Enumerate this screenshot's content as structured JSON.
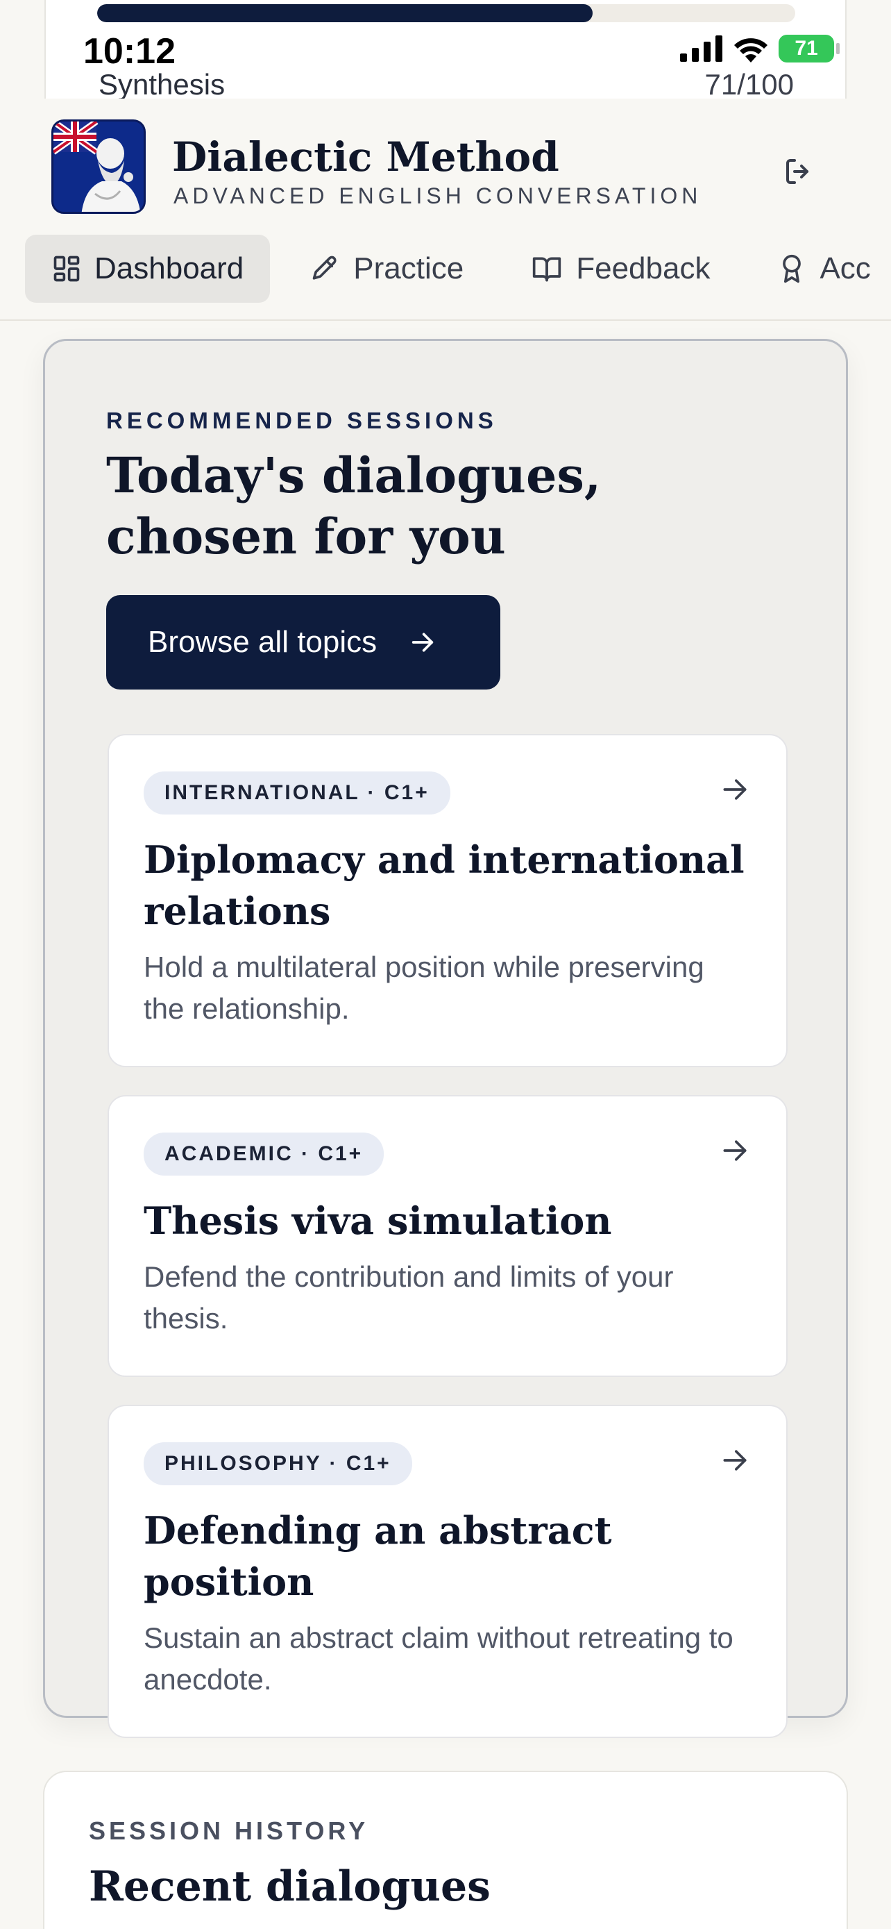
{
  "status_bar": {
    "time": "10:12",
    "battery": "71"
  },
  "progress": {
    "label": "Synthesis",
    "score_text": "71/100",
    "fraction": 0.71
  },
  "app": {
    "title": "Dialectic Method",
    "subtitle": "ADVANCED ENGLISH CONVERSATION"
  },
  "nav": {
    "items": [
      {
        "label": "Dashboard",
        "icon": "dashboard-icon",
        "active": true
      },
      {
        "label": "Practice",
        "icon": "pen-icon",
        "active": false
      },
      {
        "label": "Feedback",
        "icon": "book-icon",
        "active": false
      },
      {
        "label": "Acc",
        "icon": "award-icon",
        "active": false
      }
    ]
  },
  "recommended": {
    "eyebrow": "RECOMMENDED SESSIONS",
    "title": "Today's dialogues, chosen for you",
    "browse_label": "Browse all topics",
    "cards": [
      {
        "tag": "INTERNATIONAL · C1+",
        "title": "Diplomacy and international relations",
        "description": "Hold a multilateral position while preserving the relationship."
      },
      {
        "tag": "ACADEMIC · C1+",
        "title": "Thesis viva simulation",
        "description": "Defend the contribution and limits of your thesis."
      },
      {
        "tag": "PHILOSOPHY · C1+",
        "title": "Defending an abstract position",
        "description": "Sustain an abstract claim without retreating to anecdote."
      }
    ]
  },
  "history": {
    "eyebrow": "SESSION HISTORY",
    "title": "Recent dialogues"
  },
  "colors": {
    "navy": "#0e1c3d",
    "background": "#f8f7f3",
    "panel": "#efeeeb",
    "tag_bg": "#e8ecf5",
    "battery_green": "#34c759"
  }
}
